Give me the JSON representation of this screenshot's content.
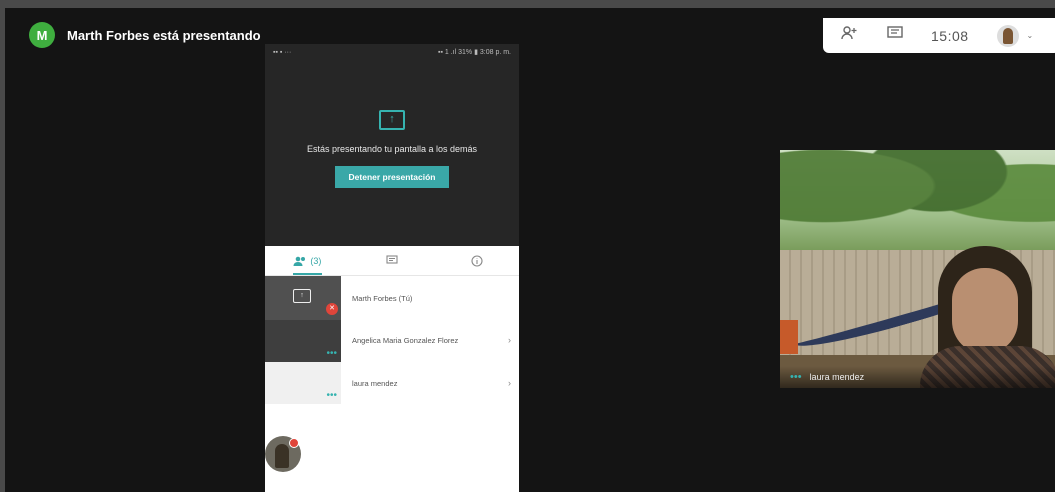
{
  "header": {
    "avatar_initial": "M",
    "presenter_text": "Marth Forbes está presentando"
  },
  "tray": {
    "people_icon": "people-icon",
    "chat_icon": "chat-icon",
    "time": "15:08",
    "caret": "⌄"
  },
  "phone": {
    "status_left": "▪▪ ▪ ···",
    "status_right": "▪▪ 1 .ıl 31% ▮ 3:08 p. m.",
    "share_panel": {
      "message": "Estás presentando tu pantalla a los demás",
      "stop_button": "Detener presentación"
    },
    "tabs": [
      {
        "label": "(3)",
        "icon": "people-icon"
      },
      {
        "label": "",
        "icon": "chat-icon"
      },
      {
        "label": "",
        "icon": "info-icon"
      }
    ],
    "participants": [
      {
        "name": "Marth Forbes (Tú)",
        "chevron": ""
      },
      {
        "name": "Angelica Maria Gonzalez Florez",
        "chevron": "›"
      },
      {
        "name": "laura mendez",
        "chevron": "›"
      }
    ],
    "dots": "•••"
  },
  "video": {
    "name": "laura mendez",
    "dots": "•••"
  },
  "colors": {
    "accent": "#36b3b0",
    "avatar_green": "#3fae3f",
    "mute_red": "#e0453a"
  }
}
